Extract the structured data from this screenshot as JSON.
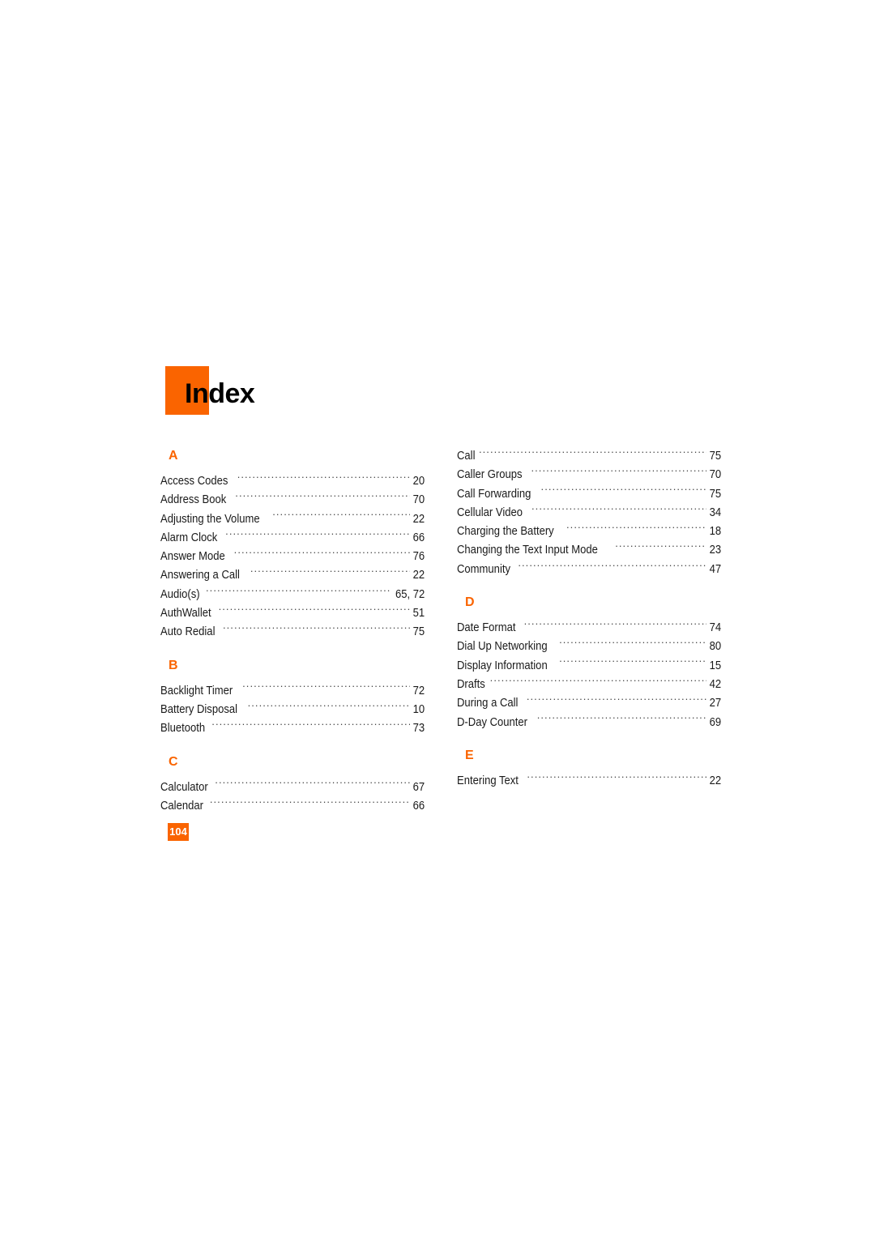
{
  "page": {
    "title": "Index",
    "page_number": "104",
    "accent_color": "#FA6400",
    "text_color": "#1a1a1a",
    "background_color": "#FFFFFF"
  },
  "columns": [
    {
      "name": "left-column",
      "sections": [
        {
          "letter": "A",
          "entries": [
            {
              "label": "Access Codes",
              "page": "20"
            },
            {
              "label": "Address Book",
              "page": "70"
            },
            {
              "label": "Adjusting the Volume",
              "page": "22"
            },
            {
              "label": "Alarm Clock",
              "page": "66"
            },
            {
              "label": "Answer Mode",
              "page": "76"
            },
            {
              "label": "Answering a Call",
              "page": "22"
            },
            {
              "label": "Audio(s)",
              "page": "65, 72"
            },
            {
              "label": "AuthWallet",
              "page": "51"
            },
            {
              "label": "Auto Redial",
              "page": "75"
            }
          ]
        },
        {
          "letter": "B",
          "entries": [
            {
              "label": "Backlight Timer",
              "page": "72"
            },
            {
              "label": "Battery Disposal",
              "page": "10"
            },
            {
              "label": "Bluetooth",
              "page": "73"
            }
          ]
        },
        {
          "letter": "C",
          "entries": [
            {
              "label": "Calculator",
              "page": "67"
            },
            {
              "label": "Calendar",
              "page": "66"
            }
          ]
        }
      ]
    },
    {
      "name": "right-column",
      "sections": [
        {
          "letter": "",
          "entries": [
            {
              "label": "Call",
              "page": "75"
            },
            {
              "label": "Caller Groups",
              "page": "70"
            },
            {
              "label": "Call Forwarding",
              "page": "75"
            },
            {
              "label": "Cellular Video",
              "page": "34"
            },
            {
              "label": "Charging the Battery",
              "page": "18"
            },
            {
              "label": "Changing the Text Input Mode",
              "page": "23"
            },
            {
              "label": "Community",
              "page": "47"
            }
          ]
        },
        {
          "letter": "D",
          "entries": [
            {
              "label": "Date Format",
              "page": "74"
            },
            {
              "label": "Dial Up Networking",
              "page": "80"
            },
            {
              "label": "Display Information",
              "page": "15"
            },
            {
              "label": "Drafts",
              "page": "42"
            },
            {
              "label": "During a Call",
              "page": "27"
            },
            {
              "label": "D-Day Counter",
              "page": "69"
            }
          ]
        },
        {
          "letter": "E",
          "entries": [
            {
              "label": "Entering Text",
              "page": "22"
            }
          ]
        }
      ]
    }
  ]
}
